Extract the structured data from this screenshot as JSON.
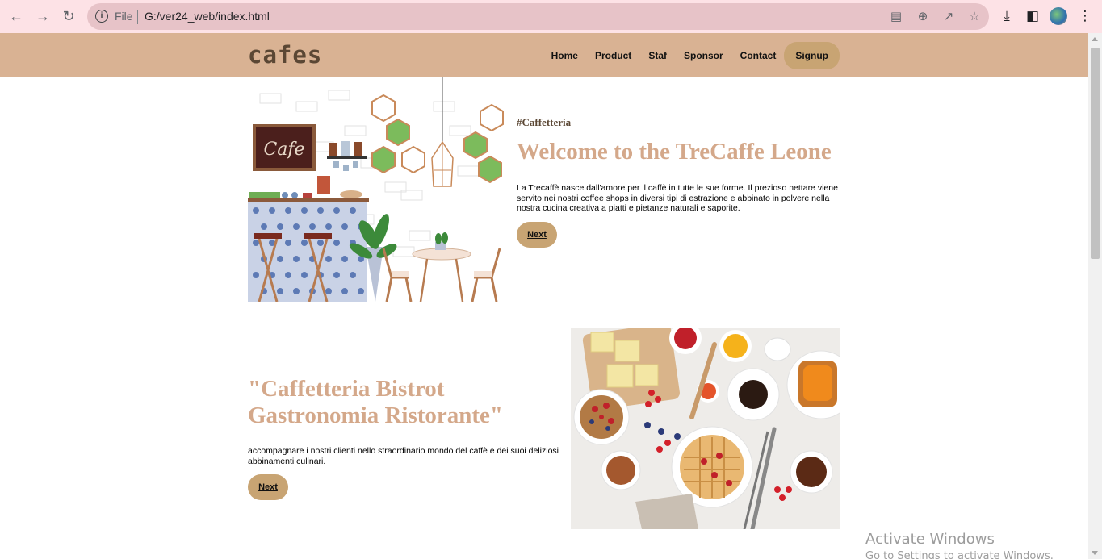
{
  "browser": {
    "scheme": "File",
    "url": "G:/ver24_web/index.html"
  },
  "header": {
    "logo": "cafes",
    "menu": [
      "Home",
      "Product",
      "Staf",
      "Sponsor",
      "Contact"
    ],
    "signup_label": "Signup"
  },
  "hero": {
    "tag": "#Caffetteria",
    "title": "Welcome to the TreCaffe Leone",
    "description": "La Trecaffè nasce dall'amore per il caffè in tutte le sue forme. Il prezioso nettare viene servito nei nostri coffee shops in diversi tipi di estrazione e abbinato in polvere nella nostra cucina creativa a piatti e pietanze naturali e saporite.",
    "button_label": "Next",
    "sign_text": "Cafe"
  },
  "bistro": {
    "title": "\"Caffetteria Bistrot Gastronomia Ristorante\"",
    "description": "accompagnare i nostri clienti nello straordinario mondo del caffè e dei suoi deliziosi abbinamenti culinari.",
    "button_label": "Next"
  },
  "watermark": {
    "line1": "Activate Windows",
    "line2": "Go to Settings to activate Windows."
  },
  "colors": {
    "header_bg": "#d9b293",
    "accent_button": "#c8a473",
    "title_color": "#d4a88a",
    "chrome_bg": "#fde2e6"
  }
}
